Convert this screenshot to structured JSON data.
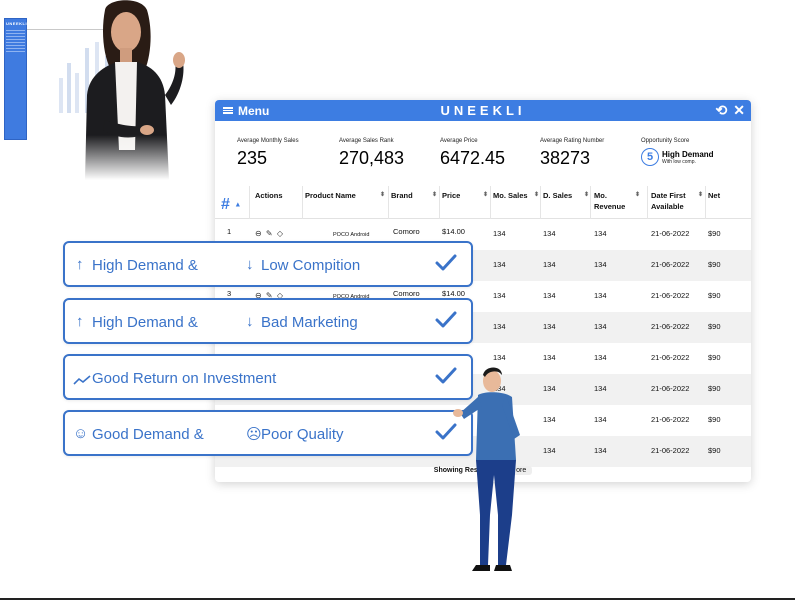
{
  "mini_panel": {
    "title": "UNEEKLI"
  },
  "app": {
    "menu_label": "Menu",
    "brand": "UNEEKLI",
    "tools": {
      "refresh_icon": "refresh-icon",
      "close_icon": "close-icon"
    }
  },
  "stats": [
    {
      "label": "Average Monthly Sales",
      "value": "235"
    },
    {
      "label": "Average Sales Rank",
      "value": "270,483"
    },
    {
      "label": "Average Price",
      "value": "6472.45"
    },
    {
      "label": "Average Rating Number",
      "value": "38273"
    }
  ],
  "opportunity": {
    "label": "Opportunity Score",
    "score": "5",
    "title": "High Demand",
    "subtitle": "With low comp."
  },
  "table": {
    "hash": "#",
    "columns": [
      "Actions",
      "Product Name",
      "Brand",
      "Price",
      "Mo. Sales",
      "D. Sales",
      "Mo. Revenue",
      "Date First Available",
      "Net"
    ],
    "rows": [
      {
        "num": "1",
        "product": "POCO Android",
        "brand": "Comoro",
        "price": "$14.00",
        "mo_sales": "134",
        "d_sales": "134",
        "mo_revenue": "134",
        "date": "21-06-2022",
        "net": "$90"
      },
      {
        "num": "",
        "product": "",
        "brand": "",
        "price": "",
        "mo_sales": "134",
        "d_sales": "134",
        "mo_revenue": "134",
        "date": "21-06-2022",
        "net": "$90"
      },
      {
        "num": "3",
        "product": "POCO Android",
        "brand": "Comoro",
        "price": "$14.00",
        "mo_sales": "134",
        "d_sales": "134",
        "mo_revenue": "134",
        "date": "21-06-2022",
        "net": "$90"
      },
      {
        "num": "",
        "product": "",
        "brand": "",
        "price": "",
        "mo_sales": "134",
        "d_sales": "134",
        "mo_revenue": "134",
        "date": "21-06-2022",
        "net": "$90"
      },
      {
        "num": "",
        "product": "",
        "brand": "",
        "price": "",
        "mo_sales": "134",
        "d_sales": "134",
        "mo_revenue": "134",
        "date": "21-06-2022",
        "net": "$90"
      },
      {
        "num": "",
        "product": "",
        "brand": "",
        "price": "",
        "mo_sales": "134",
        "d_sales": "134",
        "mo_revenue": "134",
        "date": "21-06-2022",
        "net": "$90"
      },
      {
        "num": "",
        "product": "",
        "brand": "",
        "price": "",
        "mo_sales": "134",
        "d_sales": "134",
        "mo_revenue": "134",
        "date": "21-06-2022",
        "net": "$90"
      },
      {
        "num": "",
        "product": "",
        "brand": "",
        "price": "",
        "mo_sales": "134",
        "d_sales": "134",
        "mo_revenue": "134",
        "date": "21-06-2022",
        "net": "$90"
      }
    ]
  },
  "footer": {
    "text": "Showing Results 1-40",
    "more": "ore"
  },
  "features": [
    {
      "icon": "↑",
      "text_a": "High Demand &",
      "icon_b": "↓",
      "text_b": "Low Compition"
    },
    {
      "icon": "↑",
      "text_a": "High Demand &",
      "icon_b": "↓",
      "text_b": "Bad Marketing"
    },
    {
      "icon": "trend-up-icon",
      "text_a": "Good Return on Investment",
      "icon_b": "",
      "text_b": ""
    },
    {
      "icon": "☺",
      "text_a": "Good Demand &",
      "icon_b": "☹",
      "text_b": "Poor Quality"
    }
  ],
  "colors": {
    "accent": "#3d7de2",
    "card_border": "#3a73c9"
  }
}
